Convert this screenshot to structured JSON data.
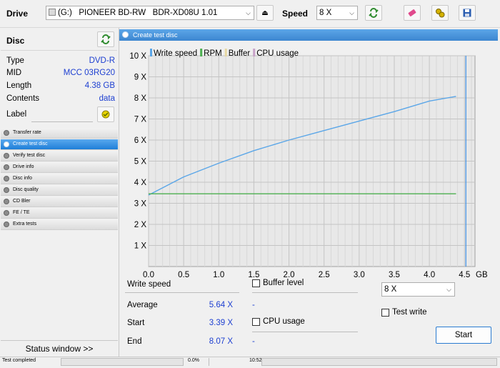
{
  "toolbar": {
    "drive_label": "Drive",
    "drive_value": "(G:)   PIONEER BD-RW   BDR-XD08U 1.01",
    "speed_label": "Speed",
    "speed_value": "8 X",
    "icons": [
      "eject-icon",
      "refresh-icon",
      "erase-icon",
      "options-icon",
      "save-icon"
    ]
  },
  "disc": {
    "header": "Disc",
    "rows": [
      {
        "key": "Type",
        "value": "DVD-R"
      },
      {
        "key": "MID",
        "value": "MCC 03RG20"
      },
      {
        "key": "Length",
        "value": "4.38 GB"
      },
      {
        "key": "Contents",
        "value": "data"
      }
    ],
    "label_key": "Label",
    "label_value": ""
  },
  "nav": {
    "items": [
      {
        "label": "Transfer rate",
        "active": false
      },
      {
        "label": "Create test disc",
        "active": true
      },
      {
        "label": "Verify test disc",
        "active": false
      },
      {
        "label": "Drive info",
        "active": false
      },
      {
        "label": "Disc info",
        "active": false
      },
      {
        "label": "Disc quality",
        "active": false
      },
      {
        "label": "CD Bler",
        "active": false
      },
      {
        "label": "FE / TE",
        "active": false
      },
      {
        "label": "Extra tests",
        "active": false
      }
    ],
    "status_window_button": "Status window >>"
  },
  "main": {
    "title": "Create test disc"
  },
  "chart_data": {
    "type": "line",
    "legend": [
      "Write speed",
      "RPM",
      "Buffer",
      "CPU usage"
    ],
    "legend_colors": [
      "#5aa6e8",
      "#4caf50",
      "#e6d7a0",
      "#c8a2c8"
    ],
    "xlabel": "",
    "ylabel": "",
    "x_unit": "GB",
    "xlim": [
      0,
      4.65
    ],
    "ylim": [
      0,
      10
    ],
    "x_ticks": [
      "0.0",
      "0.5",
      "1.0",
      "1.5",
      "2.0",
      "2.5",
      "3.0",
      "3.5",
      "4.0",
      "4.5"
    ],
    "y_ticks": [
      "1 X",
      "2 X",
      "3 X",
      "4 X",
      "5 X",
      "6 X",
      "7 X",
      "8 X",
      "9 X",
      "10 X"
    ],
    "grid": true,
    "disc_end_marker_gb": 4.38,
    "series": [
      {
        "name": "Write speed",
        "color": "#5aa6e8",
        "x": [
          0.0,
          0.5,
          1.0,
          1.5,
          2.0,
          2.5,
          3.0,
          3.5,
          4.0,
          4.38
        ],
        "values": [
          3.39,
          4.25,
          4.9,
          5.5,
          6.0,
          6.45,
          6.9,
          7.35,
          7.85,
          8.07
        ]
      },
      {
        "name": "RPM",
        "color": "#4caf50",
        "x": [
          0.0,
          4.38
        ],
        "values": [
          3.45,
          3.45
        ]
      }
    ]
  },
  "stats": {
    "write_speed_heading": "Write speed",
    "rows": [
      {
        "key": "Average",
        "value": "5.64 X",
        "dash": "-"
      },
      {
        "key": "Start",
        "value": "3.39 X"
      },
      {
        "key": "End",
        "value": "8.07 X",
        "dash": "-"
      }
    ]
  },
  "options": {
    "buffer_level_label": "Buffer level",
    "cpu_usage_label": "CPU usage",
    "speed_select_value": "8 X",
    "test_write_label": "Test write",
    "start_button": "Start"
  },
  "statusbar": {
    "status_text": "Test completed",
    "progress_text": "0.0%",
    "time_text": "10:52"
  }
}
